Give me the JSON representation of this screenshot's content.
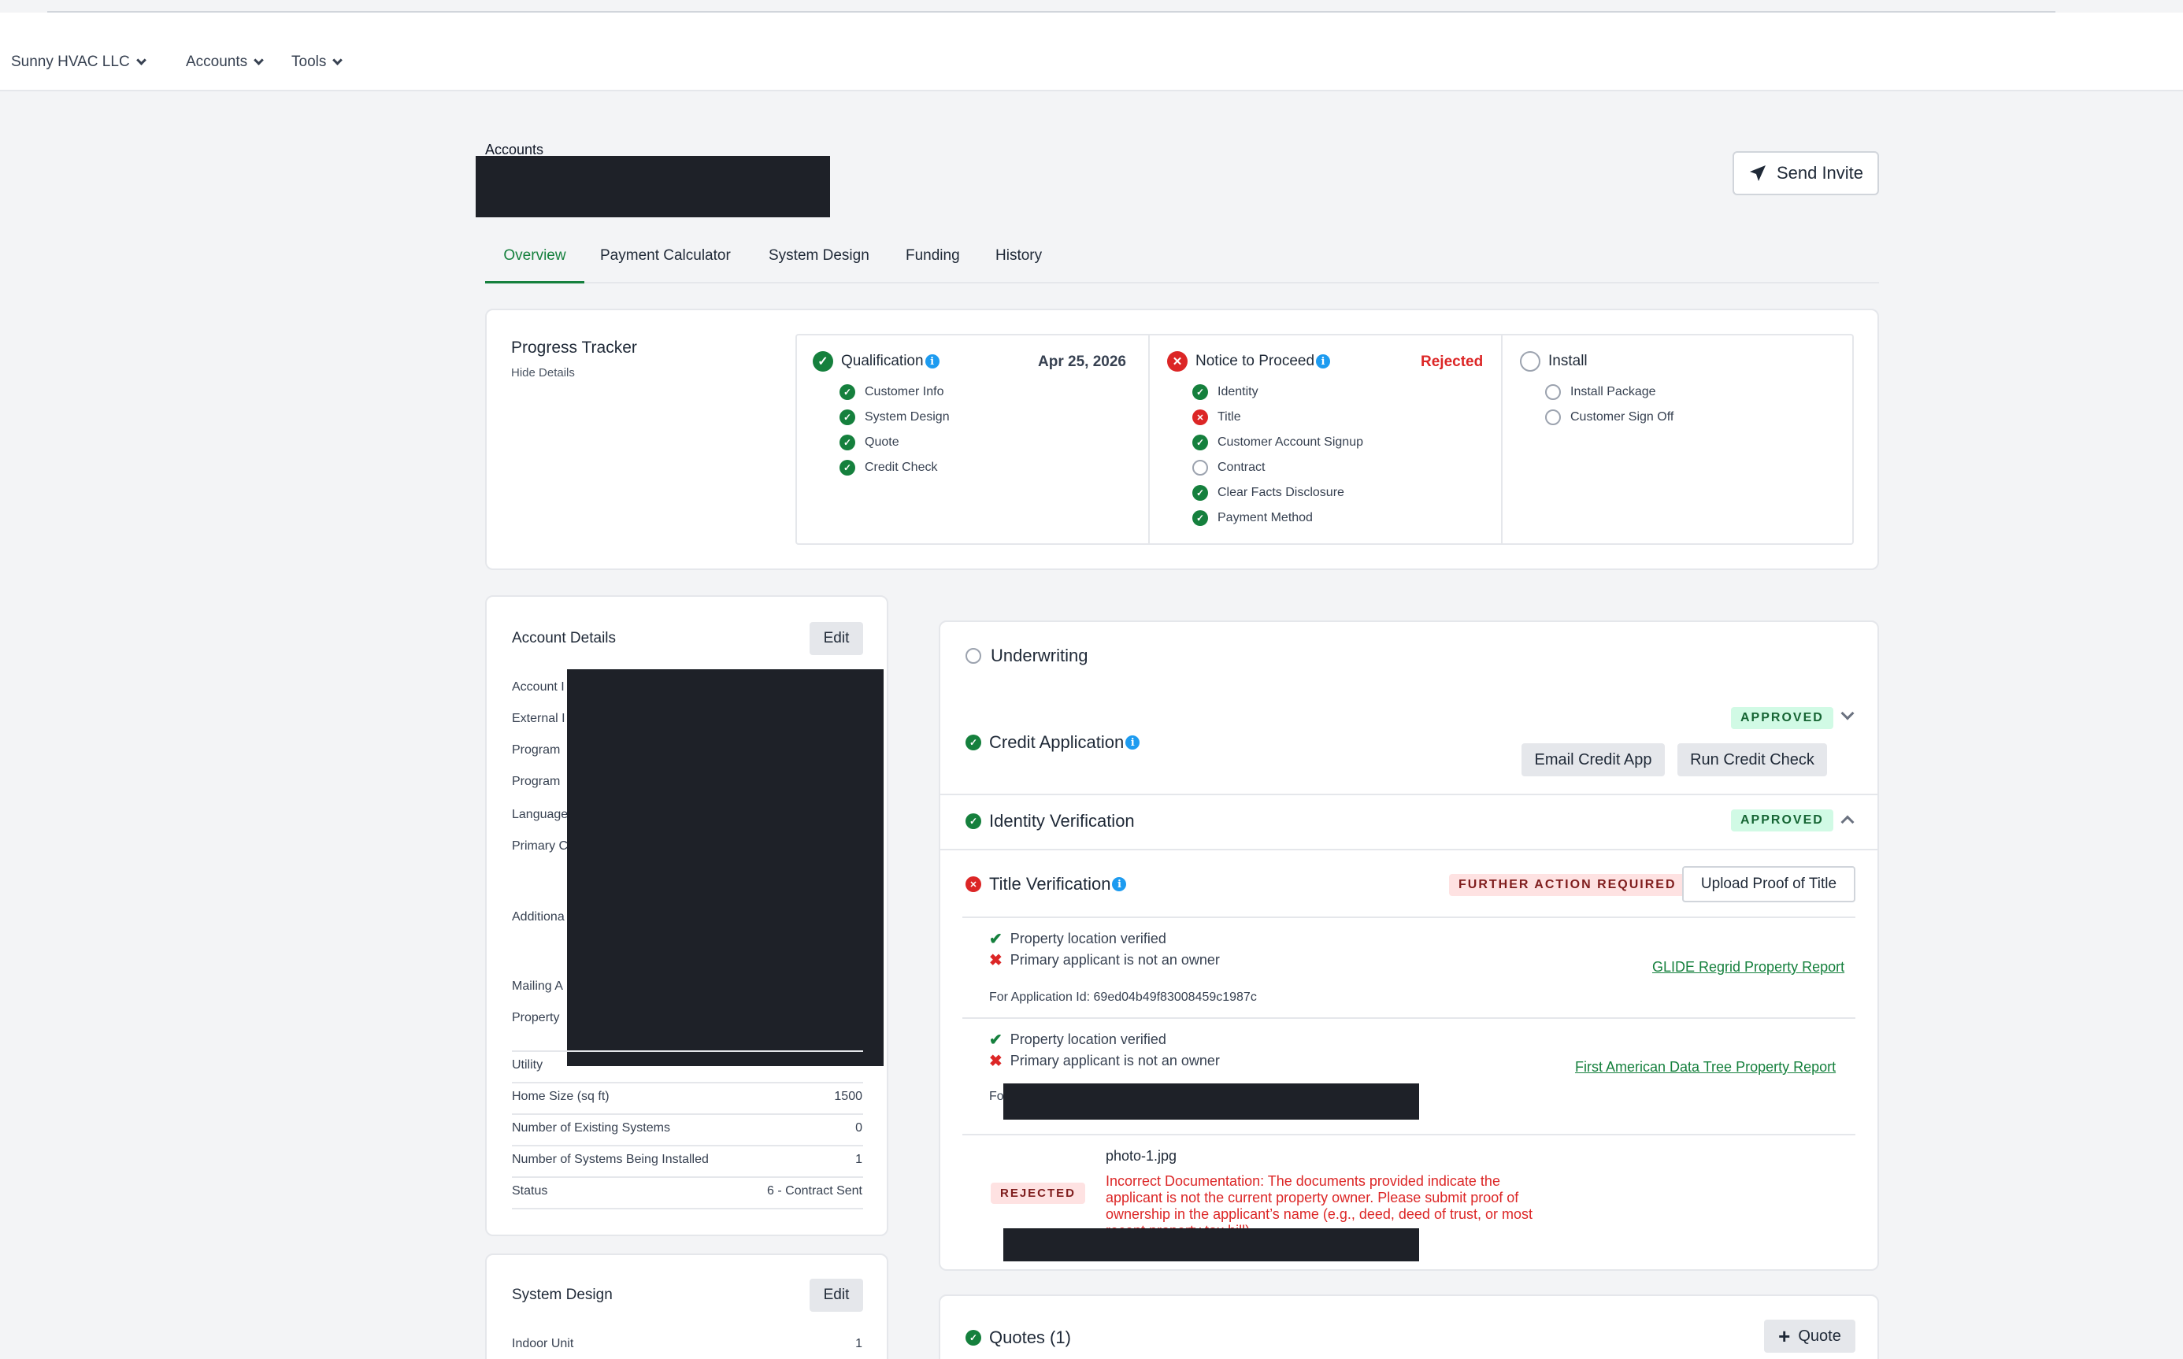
{
  "nav": {
    "company": "Sunny HVAC LLC",
    "accounts": "Accounts",
    "tools": "Tools"
  },
  "header": {
    "breadcrumb": "Accounts",
    "send_invite": "Send Invite"
  },
  "tabs": [
    "Overview",
    "Payment Calculator",
    "System Design",
    "Funding",
    "History"
  ],
  "progress": {
    "title": "Progress Tracker",
    "hide": "Hide Details",
    "qualification": {
      "label": "Qualification",
      "date": "Apr 25, 2026",
      "items": [
        "Customer Info",
        "System Design",
        "Quote",
        "Credit Check"
      ]
    },
    "ntp": {
      "label": "Notice to Proceed",
      "status": "Rejected",
      "items": [
        "Identity",
        "Title",
        "Customer Account Signup",
        "Contract",
        "Clear Facts Disclosure",
        "Payment Method"
      ]
    },
    "install": {
      "label": "Install",
      "items": [
        "Install Package",
        "Customer Sign Off"
      ]
    }
  },
  "account_details": {
    "title": "Account Details",
    "edit": "Edit",
    "labels": [
      "Account I",
      "External I",
      "Program",
      "Program",
      "Language",
      "Primary C",
      "Additiona",
      "Mailing A",
      "Property"
    ],
    "rows": [
      {
        "label": "Utility",
        "value": ""
      },
      {
        "label": "Home Size (sq ft)",
        "value": "1500"
      },
      {
        "label": "Number of Existing Systems",
        "value": "0"
      },
      {
        "label": "Number of Systems Being Installed",
        "value": "1"
      },
      {
        "label": "Status",
        "value": "6 - Contract Sent"
      }
    ]
  },
  "system_design": {
    "title": "System Design",
    "edit": "Edit",
    "indoor_label": "Indoor Unit",
    "indoor_value": "1"
  },
  "underwriting": {
    "title": "Underwriting",
    "credit": {
      "label": "Credit Application",
      "badge": "APPROVED",
      "email_btn": "Email Credit App",
      "run_btn": "Run Credit Check"
    },
    "identity": {
      "label": "Identity Verification",
      "badge": "APPROVED"
    },
    "title_ver": {
      "label": "Title Verification",
      "badge": "FURTHER ACTION REQUIRED",
      "upload_btn": "Upload Proof of Title",
      "report1": {
        "ok": "Property location verified",
        "fail": "Primary applicant is not an owner",
        "link": "GLIDE Regrid Property Report",
        "app_id": "For Application Id: 69ed04b49f83008459c1987c"
      },
      "report2": {
        "ok": "Property location verified",
        "fail": "Primary applicant is not an owner",
        "link": "First American Data Tree Property Report",
        "app_id_prefix": "Fo"
      },
      "doc": {
        "badge": "REJECTED",
        "file": "photo-1.jpg",
        "reason_1": "Incorrect Documentation: The documents provided indicate the",
        "reason_2": "applicant is not the current property owner. Please submit proof of",
        "reason_3": "ownership in the applicant’s name (e.g., deed, deed of trust, or most",
        "reason_4": "recent property tax bill)."
      }
    }
  },
  "quotes": {
    "title": "Quotes (1)",
    "btn": "Quote"
  }
}
